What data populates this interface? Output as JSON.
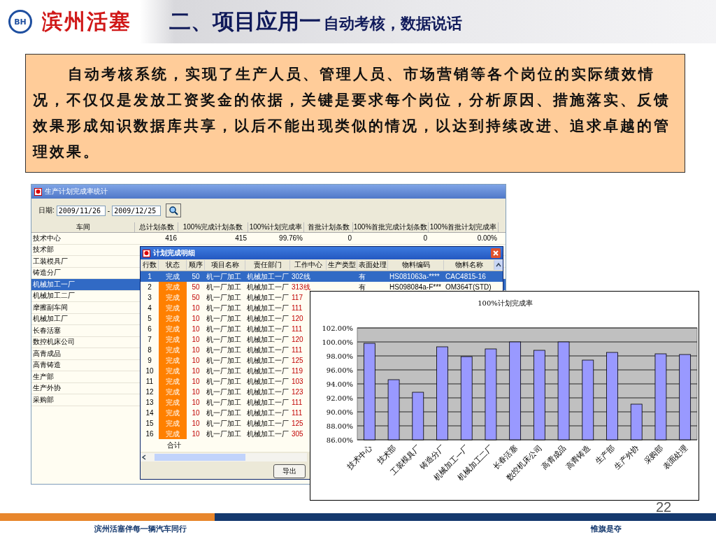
{
  "header": {
    "logo_text": "BH",
    "brand": "滨州活塞",
    "title": "二、项目应用一",
    "subtitle": "自动考核，数据说话"
  },
  "summary": {
    "text": "自动考核系统，实现了生产人员、管理人员、市场营销等各个岗位的实际绩效情况，不仅仅是发放工资奖金的依据，关键是要求每个岗位，分析原因、措施落实、反馈效果形成知识数据库共享，以后不能出现类似的情况，以达到持续改进、追求卓越的管理效果。"
  },
  "report_window": {
    "title": "生产计划完成率统计",
    "date_label": "日期:",
    "date_from": "2009/11/26",
    "date_separator": "-",
    "date_to": "2009/12/25",
    "columns": [
      "车间",
      "总计划条数",
      "100%完成计划条数",
      "100%计划完成率",
      "首批计划条数",
      "100%首批完成计划条数",
      "100%首批计划完成率"
    ],
    "rows": [
      {
        "cells": [
          "技术中心",
          "416",
          "415",
          "99.76%",
          "0",
          "0",
          "0.00%"
        ],
        "selected": false
      },
      {
        "cells": [
          "技术部"
        ],
        "selected": false
      },
      {
        "cells": [
          "工装模具厂"
        ],
        "selected": false
      },
      {
        "cells": [
          "铸造分厂"
        ],
        "selected": false
      },
      {
        "cells": [
          "机械加工一厂"
        ],
        "selected": true
      },
      {
        "cells": [
          "机械加工二厂"
        ],
        "selected": false
      },
      {
        "cells": [
          "摩擦副车间"
        ],
        "selected": false
      },
      {
        "cells": [
          "机械加工厂"
        ],
        "selected": false
      },
      {
        "cells": [
          "长春活塞"
        ],
        "selected": false
      },
      {
        "cells": [
          "数控机床公司"
        ],
        "selected": false
      },
      {
        "cells": [
          "高青成品"
        ],
        "selected": false
      },
      {
        "cells": [
          "高青铸造"
        ],
        "selected": false
      },
      {
        "cells": [
          "生产部"
        ],
        "selected": false
      },
      {
        "cells": [
          "生产外协"
        ],
        "selected": false
      },
      {
        "cells": [
          "采购部"
        ],
        "selected": false
      }
    ]
  },
  "detail_dialog": {
    "title": "计划完成明细",
    "columns": [
      "行数",
      "状态",
      "顺序",
      "项目名称",
      "责任部门",
      "工作中心",
      "生产类型",
      "表面处理",
      "物料编码",
      "物料名称"
    ],
    "rows": [
      {
        "cells": [
          "1",
          "完成",
          "50",
          "机一厂加工",
          "机械加工一厂",
          "302线",
          "",
          "有",
          "HS081063a-****",
          "CAC4815-16"
        ],
        "selected": true
      },
      {
        "cells": [
          "2",
          "完成",
          "50",
          "机一厂加工",
          "机械加工一厂",
          "313线",
          "",
          "有",
          "HS098084a-F***",
          "OM364T(STD)"
        ],
        "selected": false
      },
      {
        "cells": [
          "3",
          "完成",
          "50",
          "机一厂加工",
          "机械加工一厂",
          "117"
        ],
        "selected": false
      },
      {
        "cells": [
          "4",
          "完成",
          "10",
          "机一厂加工",
          "机械加工一厂",
          "111"
        ],
        "selected": false
      },
      {
        "cells": [
          "5",
          "完成",
          "10",
          "机一厂加工",
          "机械加工一厂",
          "120"
        ],
        "selected": false
      },
      {
        "cells": [
          "6",
          "完成",
          "10",
          "机一厂加工",
          "机械加工一厂",
          "111"
        ],
        "selected": false
      },
      {
        "cells": [
          "7",
          "完成",
          "10",
          "机一厂加工",
          "机械加工一厂",
          "120"
        ],
        "selected": false
      },
      {
        "cells": [
          "8",
          "完成",
          "10",
          "机一厂加工",
          "机械加工一厂",
          "111"
        ],
        "selected": false
      },
      {
        "cells": [
          "9",
          "完成",
          "10",
          "机一厂加工",
          "机械加工一厂",
          "125"
        ],
        "selected": false
      },
      {
        "cells": [
          "10",
          "完成",
          "10",
          "机一厂加工",
          "机械加工一厂",
          "119"
        ],
        "selected": false
      },
      {
        "cells": [
          "11",
          "完成",
          "10",
          "机一厂加工",
          "机械加工一厂",
          "103"
        ],
        "selected": false
      },
      {
        "cells": [
          "12",
          "完成",
          "10",
          "机一厂加工",
          "机械加工一厂",
          "123"
        ],
        "selected": false
      },
      {
        "cells": [
          "13",
          "完成",
          "10",
          "机一厂加工",
          "机械加工一厂",
          "111"
        ],
        "selected": false
      },
      {
        "cells": [
          "14",
          "完成",
          "10",
          "机一厂加工",
          "机械加工一厂",
          "111"
        ],
        "selected": false
      },
      {
        "cells": [
          "15",
          "完成",
          "10",
          "机一厂加工",
          "机械加工一厂",
          "125"
        ],
        "selected": false
      },
      {
        "cells": [
          "16",
          "完成",
          "10",
          "机一厂加工",
          "机械加工一厂",
          "305"
        ],
        "selected": false
      }
    ],
    "total_label": "合计",
    "export_button": "导出"
  },
  "chart": {
    "chart_data": {
      "type": "bar",
      "title": "100%计划完成率",
      "categories": [
        "技术中心",
        "技术部",
        "工装模具厂",
        "铸造分厂",
        "机械加工一厂",
        "机械加工二厂",
        "长春活塞",
        "数控机床公司",
        "高青成品",
        "高青铸造",
        "生产部",
        "生产外协",
        "采购部",
        "表面处理"
      ],
      "grid": true,
      "series": [
        {
          "color": "#9999ff",
          "values": [
            99.8,
            94.6,
            92.8,
            99.3,
            97.9,
            99.0,
            100.0,
            98.8,
            100.0,
            97.4,
            98.5,
            91.1,
            98.3,
            98.2
          ]
        }
      ],
      "ylim": [
        86,
        102
      ],
      "yticks": [
        {
          "value": 86,
          "label": "86.00%"
        },
        {
          "value": 88,
          "label": "88.00%"
        },
        {
          "value": 90,
          "label": "90.00%"
        },
        {
          "value": 92,
          "label": "92.00%"
        },
        {
          "value": 94,
          "label": "94.00%"
        },
        {
          "value": 96,
          "label": "96.00%"
        },
        {
          "value": 98,
          "label": "98.00%"
        },
        {
          "value": 100,
          "label": "100.00%"
        },
        {
          "value": 102,
          "label": "102.00%"
        }
      ]
    }
  },
  "page_number": "22",
  "footer": {
    "slogan_left": "滨州活塞伴每一辆汽车同行",
    "slogan_right": "惟旗是夺"
  }
}
